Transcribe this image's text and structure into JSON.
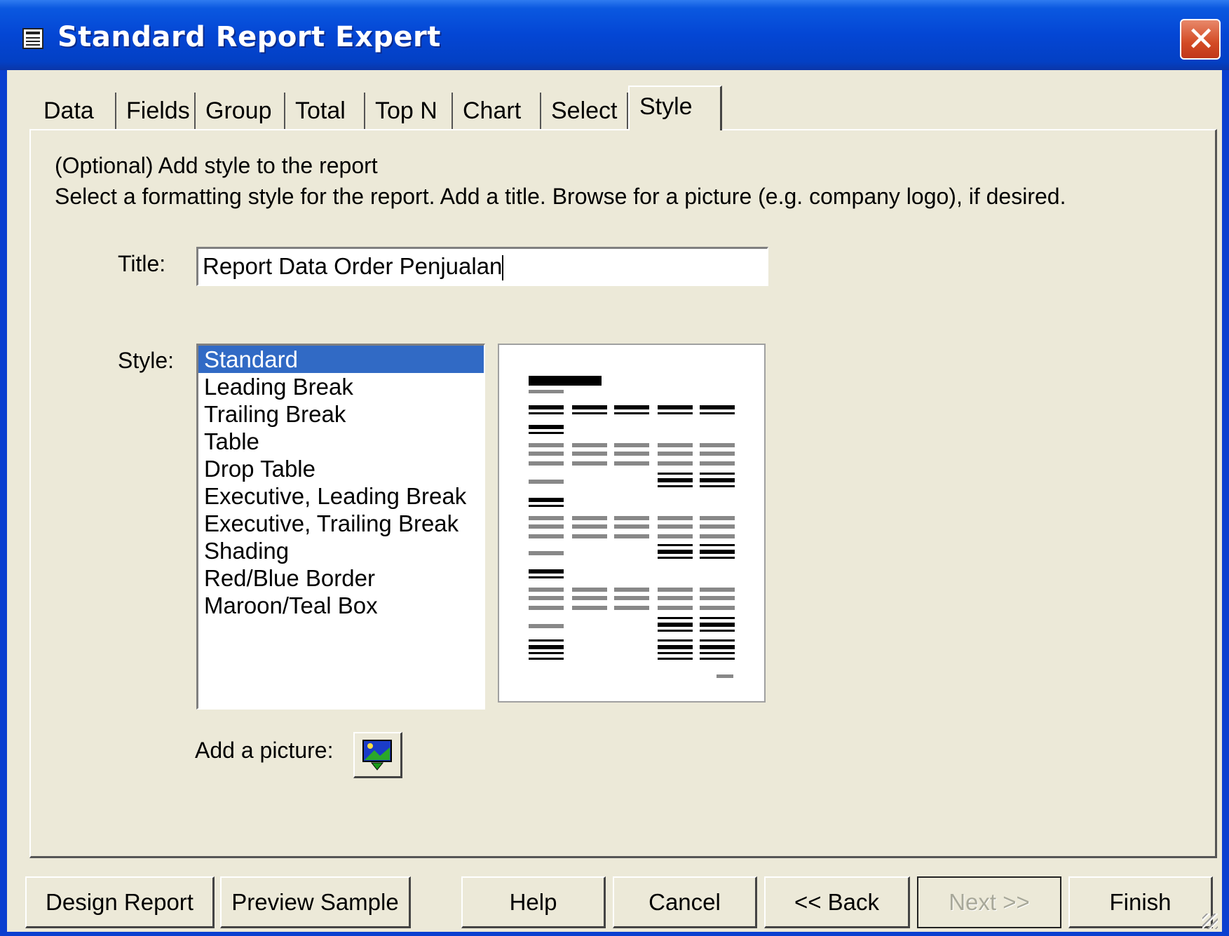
{
  "window": {
    "title": "Standard Report Expert",
    "close_label": "✕"
  },
  "tabs": [
    {
      "label": "Data",
      "active": false
    },
    {
      "label": "Fields",
      "active": false
    },
    {
      "label": "Group",
      "active": false
    },
    {
      "label": "Total",
      "active": false
    },
    {
      "label": "Top N",
      "active": false
    },
    {
      "label": "Chart",
      "active": false
    },
    {
      "label": "Select",
      "active": false
    },
    {
      "label": "Style",
      "active": true
    }
  ],
  "style_page": {
    "desc_line1": "(Optional) Add style to the report",
    "desc_line2": "Select a formatting style for the report.  Add a title.  Browse for a picture (e.g. company logo), if desired.",
    "title_label": "Title:",
    "title_value": "Report Data Order Penjualan",
    "style_label": "Style:",
    "styles": [
      "Standard",
      "Leading Break",
      "Trailing Break",
      "Table",
      "Drop Table",
      "Executive, Leading Break",
      "Executive, Trailing Break",
      "Shading",
      "Red/Blue Border",
      "Maroon/Teal Box"
    ],
    "selected_style": "Standard",
    "add_picture_label": "Add a picture:"
  },
  "buttons": {
    "design_report": "Design Report",
    "preview_sample": "Preview Sample",
    "help": "Help",
    "cancel": "Cancel",
    "back": "<< Back",
    "next": "Next >>",
    "finish": "Finish"
  },
  "colors": {
    "selection": "#316ac5",
    "titlebar": "#0446d4",
    "dialog_bg": "#ece9d8"
  }
}
